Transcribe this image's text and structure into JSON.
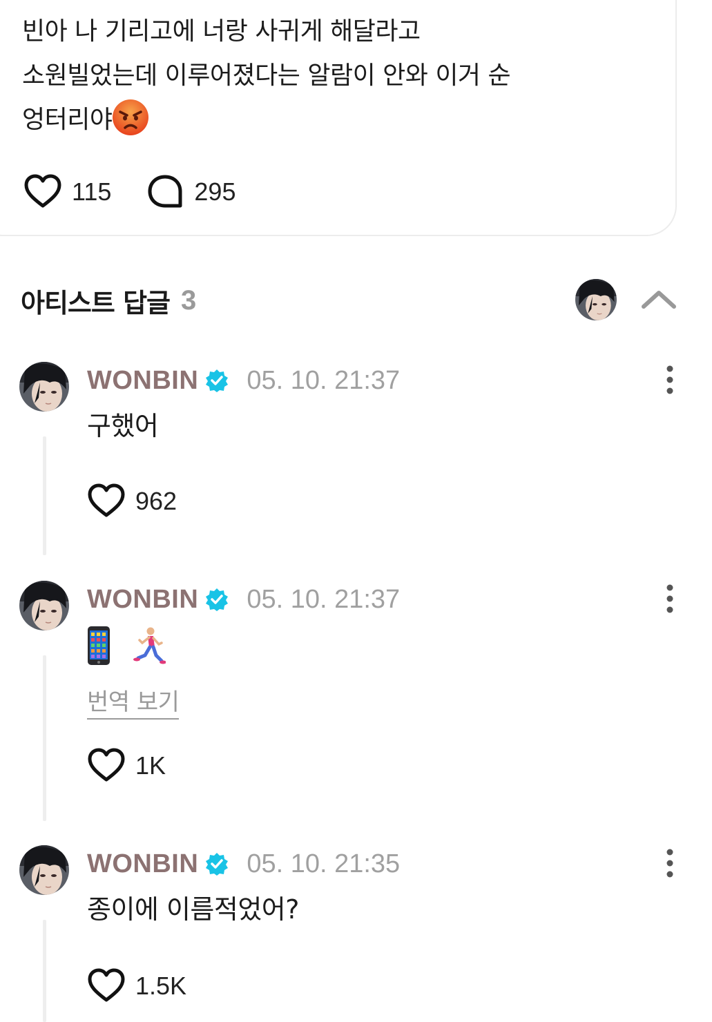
{
  "post": {
    "lines": [
      "빈아 나 기리고에 너랑 사귀게 해달라고",
      "소원빌었는데 이루어졌다는 알람이 안와 이거 순",
      "엉터리야"
    ],
    "emoji": "angry-face-emoji",
    "likes": "115",
    "comments": "295"
  },
  "replies_section": {
    "title": "아티스트 답글",
    "count": "3"
  },
  "comments": [
    {
      "author": "WONBIN",
      "time": "05. 10. 21:37",
      "text": "구했어",
      "likes": "962"
    },
    {
      "author": "WONBIN",
      "time": "05. 10. 21:37",
      "emojis": [
        "mobile-phone-emoji",
        "person-running-emoji"
      ],
      "translate_label": "번역 보기",
      "likes": "1K"
    },
    {
      "author": "WONBIN",
      "time": "05. 10. 21:35",
      "text": "종이에 이름적었어?",
      "likes": "1.5K"
    }
  ],
  "colors": {
    "author": "#8c7272",
    "verified": "#19c3e6",
    "muted": "#a0a0a0",
    "divider": "#eeeeee"
  }
}
